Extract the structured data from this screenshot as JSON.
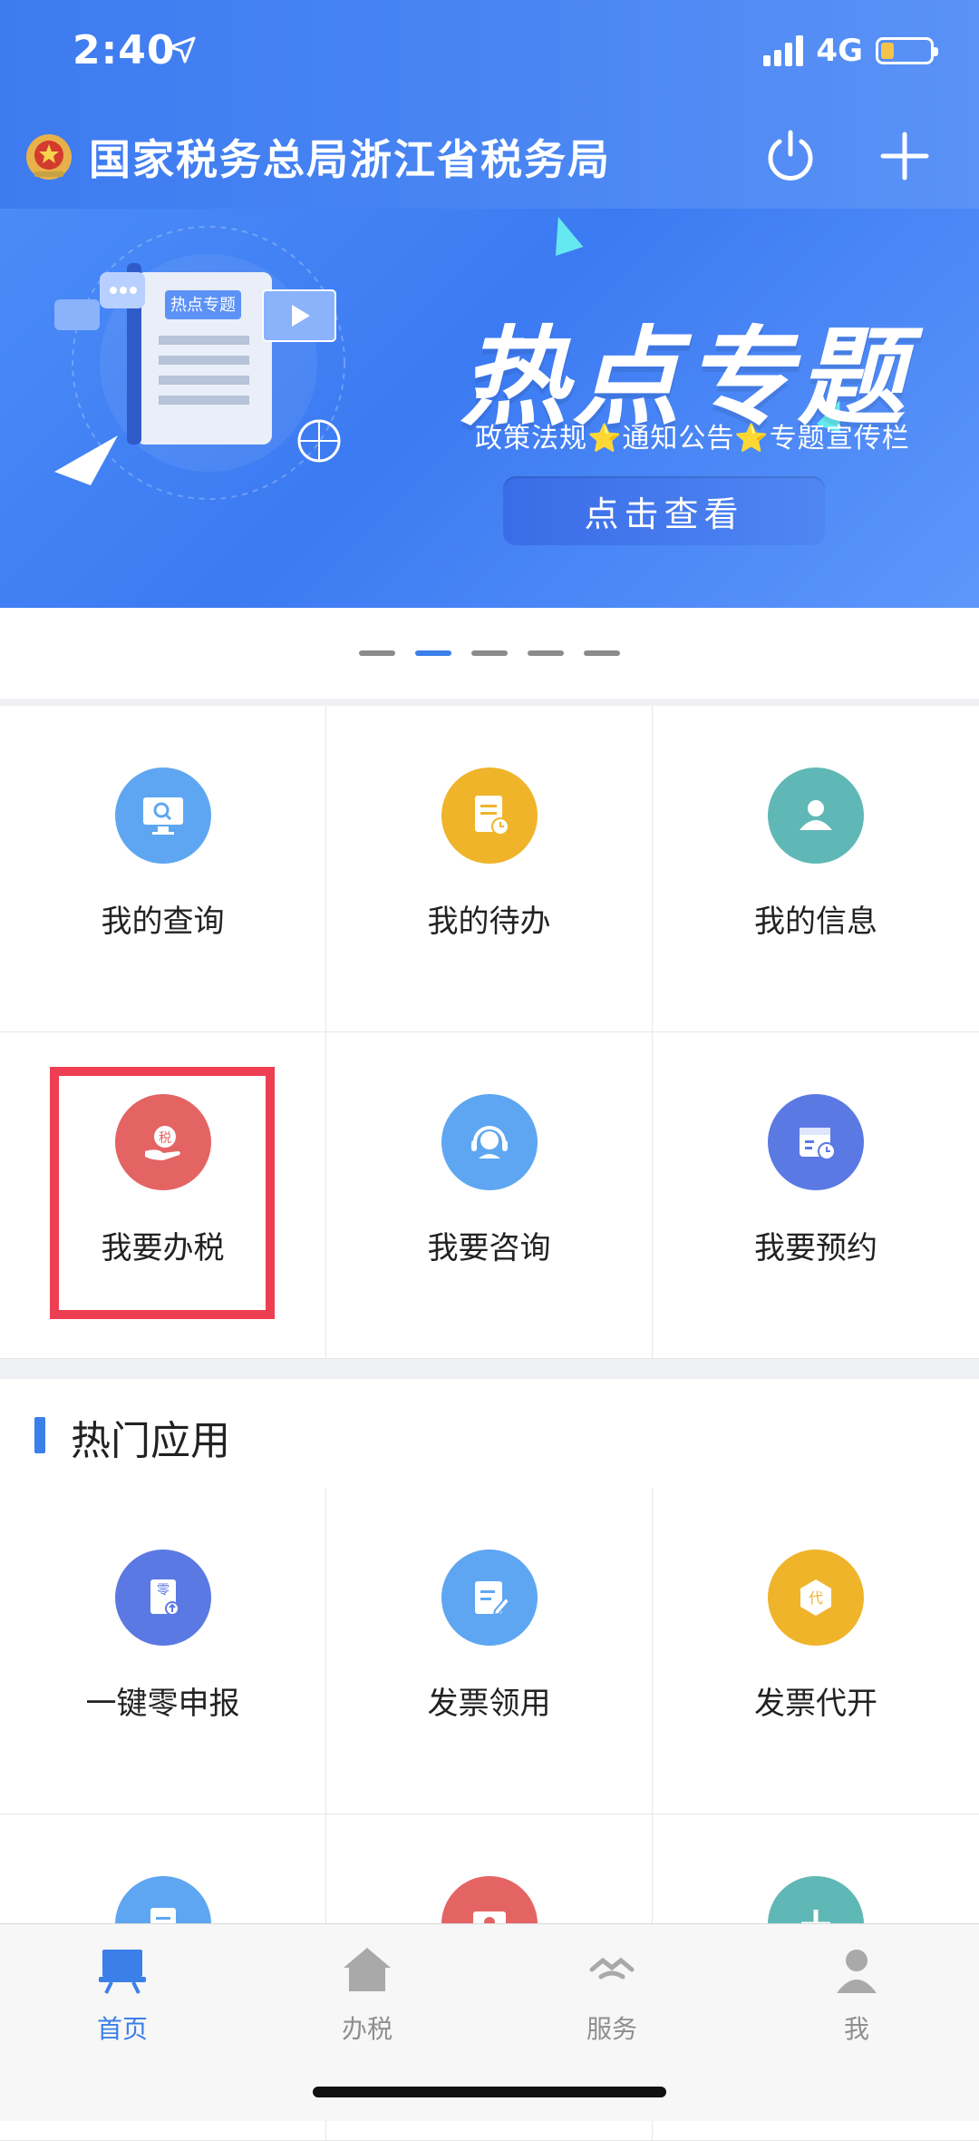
{
  "status": {
    "time": "2:40",
    "network": "4G"
  },
  "header": {
    "title": "国家税务总局浙江省税务局"
  },
  "banner": {
    "title": "热点专题",
    "subtitle": "政策法规⭐通知公告⭐专题宣传栏",
    "button": "点击查看",
    "doc_tag": "热点专题"
  },
  "carousel": {
    "active_index": 1,
    "count": 5
  },
  "grid_main": [
    {
      "label": "我的查询",
      "icon": "monitor-search-icon",
      "color": "#5ea6f2"
    },
    {
      "label": "我的待办",
      "icon": "todo-document-icon",
      "color": "#f0b42a"
    },
    {
      "label": "我的信息",
      "icon": "user-profile-icon",
      "color": "#60b8b6"
    },
    {
      "label": "我要办税",
      "icon": "hand-tax-icon",
      "color": "#e46464"
    },
    {
      "label": "我要咨询",
      "icon": "headset-support-icon",
      "color": "#5ea6f2"
    },
    {
      "label": "我要预约",
      "icon": "calendar-clock-icon",
      "color": "#5b79e3"
    }
  ],
  "section": {
    "title": "热门应用"
  },
  "grid_apps": [
    {
      "label": "一键零申报",
      "icon": "zero-declare-icon",
      "color": "#5b79e3",
      "glyph": "零"
    },
    {
      "label": "发票领用",
      "icon": "invoice-edit-icon",
      "color": "#5ea6f2"
    },
    {
      "label": "发票代开",
      "icon": "invoice-agent-icon",
      "color": "#f0b42a",
      "glyph": "代"
    },
    {
      "label": "",
      "icon": "document-icon",
      "color": "#5ea6f2"
    },
    {
      "label": "",
      "icon": "certificate-icon",
      "color": "#e46464"
    },
    {
      "label": "",
      "icon": "plus-app-icon",
      "color": "#60b8b6"
    }
  ],
  "tabbar": [
    {
      "label": "首页",
      "icon": "home-board-icon"
    },
    {
      "label": "办税",
      "icon": "house-icon"
    },
    {
      "label": "服务",
      "icon": "service-handshake-icon"
    },
    {
      "label": "我",
      "icon": "profile-icon"
    }
  ],
  "colors": {
    "primary": "#3b7fe9",
    "highlight": "#ee3e52"
  }
}
